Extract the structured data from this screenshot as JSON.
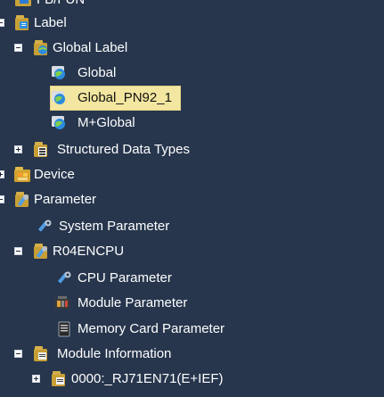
{
  "tree": {
    "top_item": {
      "label": "FB/FUN",
      "icon": "fbfun-folder-icon"
    },
    "label_root": {
      "label": "Label",
      "icon": "label-folder-icon",
      "expanded": true
    },
    "global_label": {
      "label": "Global Label",
      "icon": "global-label-icon",
      "expanded": true
    },
    "global": {
      "label": "Global",
      "icon": "global-icon"
    },
    "global_pn92": {
      "label": "Global_PN92_1",
      "icon": "global-icon",
      "selected": true
    },
    "m_global": {
      "label": "M+Global",
      "icon": "global-icon"
    },
    "structured_types": {
      "label": "Structured Data Types",
      "icon": "structured-data-icon",
      "expanded": false
    },
    "device": {
      "label": "Device",
      "icon": "device-folder-icon",
      "expanded": false
    },
    "parameter": {
      "label": "Parameter",
      "icon": "parameter-folder-icon",
      "expanded": true
    },
    "system_parameter": {
      "label": "System Parameter",
      "icon": "system-parameter-icon"
    },
    "r04encpu": {
      "label": "R04ENCPU",
      "icon": "cpu-folder-icon",
      "expanded": true
    },
    "cpu_parameter": {
      "label": "CPU Parameter",
      "icon": "cpu-parameter-icon"
    },
    "module_parameter": {
      "label": "Module Parameter",
      "icon": "module-parameter-icon"
    },
    "memory_card_parameter": {
      "label": "Memory Card Parameter",
      "icon": "memory-card-icon"
    },
    "module_information": {
      "label": "Module Information",
      "icon": "module-info-icon",
      "expanded": true
    },
    "module_0000": {
      "label": "0000:_RJ71EN71(E+IEF)",
      "icon": "module-info-icon",
      "expanded": false
    }
  },
  "colors": {
    "background": "#27364d",
    "selection_fill": "#f2e6a0",
    "text": "#ffffff"
  }
}
